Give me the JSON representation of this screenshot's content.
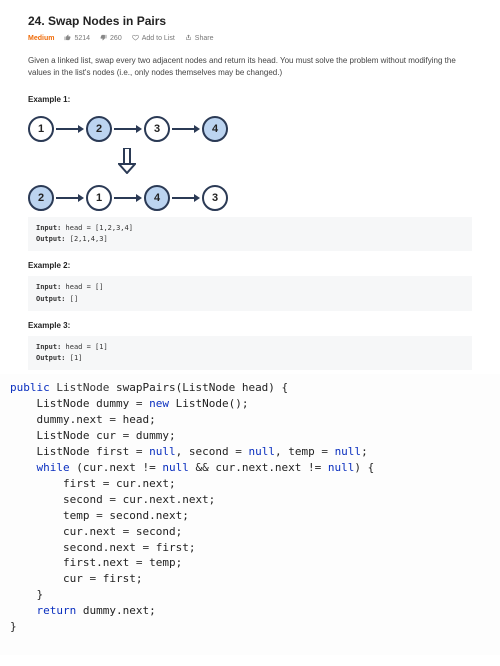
{
  "header": {
    "title": "24. Swap Nodes in Pairs",
    "difficulty": "Medium",
    "likes": "5214",
    "dislikes": "260",
    "add_to_list": "Add to List",
    "share": "Share"
  },
  "description": "Given a linked list, swap every two adjacent nodes and return its head. You must solve the problem without modifying the values in the list's nodes (i.e., only nodes themselves may be changed.)",
  "examples": [
    {
      "title": "Example 1:",
      "input_label": "Input:",
      "input_value": " head = [1,2,3,4]",
      "output_label": "Output:",
      "output_value": " [2,1,4,3]"
    },
    {
      "title": "Example 2:",
      "input_label": "Input:",
      "input_value": " head = []",
      "output_label": "Output:",
      "output_value": " []"
    },
    {
      "title": "Example 3:",
      "input_label": "Input:",
      "input_value": " head = [1]",
      "output_label": "Output:",
      "output_value": " [1]"
    }
  ],
  "diagram_nodes_before": [
    "1",
    "2",
    "3",
    "4"
  ],
  "diagram_nodes_after": [
    "2",
    "1",
    "4",
    "3"
  ],
  "code": {
    "kw_public": "public",
    "ret_type": "ListNode",
    "fn_name": "swapPairs",
    "param": "(ListNode head) {",
    "l1a": "    ListNode dummy ",
    "l1b": " ListNode();",
    "l2": "    dummy.next ",
    "l2b": " head;",
    "l3": "    ListNode cur ",
    "l3b": " dummy;",
    "l4a": "    ListNode first ",
    "l4b": ", second ",
    "l4c": ", temp ",
    "l4d": ";",
    "while": "while",
    "cond": " (cur.next != ",
    "cond2": " && cur.next.next != ",
    "cond3": ") {",
    "b1": "        first ",
    "b1b": " cur.next;",
    "b2": "        second ",
    "b2b": " cur.next.next;",
    "b3": "        temp ",
    "b3b": " second.next;",
    "b4": "        cur.next ",
    "b4b": " second;",
    "b5": "        second.next ",
    "b5b": " first;",
    "b6": "        first.next ",
    "b6b": " temp;",
    "b7": "        cur ",
    "b7b": " first;",
    "close_inner": "    }",
    "ret": "return",
    "ret_val": " dummy.next;",
    "close_outer": "}",
    "new": "new",
    "null": "null",
    "eq": "="
  }
}
